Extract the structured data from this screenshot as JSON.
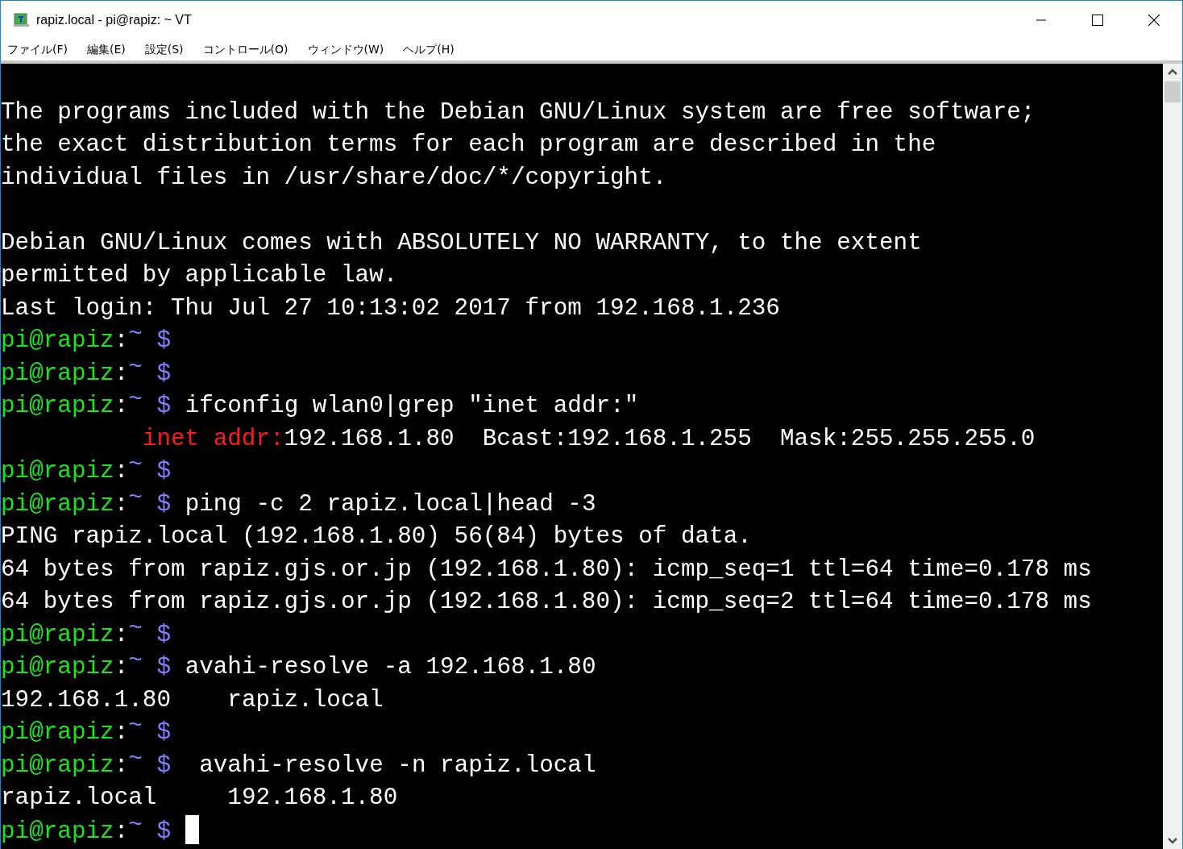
{
  "window": {
    "title": "rapiz.local - pi@rapiz: ~ VT"
  },
  "menu": [
    {
      "label": "ファイル(F)"
    },
    {
      "label": "編集(E)"
    },
    {
      "label": "設定(S)"
    },
    {
      "label": "コントロール(O)"
    },
    {
      "label": "ウィンドウ(W)"
    },
    {
      "label": "ヘルプ(H)"
    }
  ],
  "terminal": {
    "lines": [
      {
        "kind": "blank"
      },
      {
        "kind": "output",
        "segments": [
          {
            "text": "The programs included with the Debian GNU/Linux system are free software;",
            "highlight": false
          }
        ]
      },
      {
        "kind": "output",
        "segments": [
          {
            "text": "the exact distribution terms for each program are described in the",
            "highlight": false
          }
        ]
      },
      {
        "kind": "output",
        "segments": [
          {
            "text": "individual files in /usr/share/doc/*/copyright.",
            "highlight": false
          }
        ]
      },
      {
        "kind": "blank"
      },
      {
        "kind": "output",
        "segments": [
          {
            "text": "Debian GNU/Linux comes with ABSOLUTELY NO WARRANTY, to the extent",
            "highlight": false
          }
        ]
      },
      {
        "kind": "output",
        "segments": [
          {
            "text": "permitted by applicable law.",
            "highlight": false
          }
        ]
      },
      {
        "kind": "output",
        "segments": [
          {
            "text": "Last login: Thu Jul 27 10:13:02 2017 from 192.168.1.236",
            "highlight": false
          }
        ]
      },
      {
        "kind": "prompt",
        "user": "pi@rapiz",
        "sep": ":",
        "dir": "~",
        "sigil": "$"
      },
      {
        "kind": "prompt",
        "user": "pi@rapiz",
        "sep": ":",
        "dir": "~",
        "sigil": "$"
      },
      {
        "kind": "prompt",
        "user": "pi@rapiz",
        "sep": ":",
        "dir": "~",
        "sigil": "$",
        "command": "ifconfig wlan0|grep \"inet addr:\""
      },
      {
        "kind": "indented_output",
        "segments": [
          {
            "text": "inet addr:",
            "highlight": true
          },
          {
            "text": "192.168.1.80  Bcast:192.168.1.255  Mask:255.255.255.0",
            "highlight": false
          }
        ]
      },
      {
        "kind": "prompt",
        "user": "pi@rapiz",
        "sep": ":",
        "dir": "~",
        "sigil": "$"
      },
      {
        "kind": "prompt",
        "user": "pi@rapiz",
        "sep": ":",
        "dir": "~",
        "sigil": "$",
        "command": "ping -c 2 rapiz.local|head -3"
      },
      {
        "kind": "output",
        "segments": [
          {
            "text": "PING rapiz.local (192.168.1.80) 56(84) bytes of data.",
            "highlight": false
          }
        ]
      },
      {
        "kind": "output",
        "segments": [
          {
            "text": "64 bytes from rapiz.gjs.or.jp (192.168.1.80): icmp_seq=1 ttl=64 time=0.178 ms",
            "highlight": false
          }
        ]
      },
      {
        "kind": "output",
        "segments": [
          {
            "text": "64 bytes from rapiz.gjs.or.jp (192.168.1.80): icmp_seq=2 ttl=64 time=0.178 ms",
            "highlight": false
          }
        ]
      },
      {
        "kind": "prompt",
        "user": "pi@rapiz",
        "sep": ":",
        "dir": "~",
        "sigil": "$"
      },
      {
        "kind": "prompt",
        "user": "pi@rapiz",
        "sep": ":",
        "dir": "~",
        "sigil": "$",
        "command": "avahi-resolve -a 192.168.1.80"
      },
      {
        "kind": "output",
        "segments": [
          {
            "text": "192.168.1.80    rapiz.local",
            "highlight": false
          }
        ]
      },
      {
        "kind": "prompt",
        "user": "pi@rapiz",
        "sep": ":",
        "dir": "~",
        "sigil": "$"
      },
      {
        "kind": "prompt",
        "user": "pi@rapiz",
        "sep": ":",
        "dir": "~",
        "sigil": "$",
        "command": " avahi-resolve -n rapiz.local"
      },
      {
        "kind": "output",
        "segments": [
          {
            "text": "rapiz.local     192.168.1.80",
            "highlight": false
          }
        ]
      },
      {
        "kind": "prompt",
        "user": "pi@rapiz",
        "sep": ":",
        "dir": "~",
        "sigil": "$",
        "cursor": true
      }
    ]
  }
}
